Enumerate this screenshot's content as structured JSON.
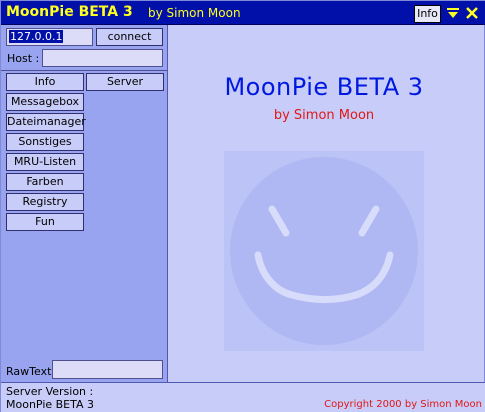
{
  "titlebar": {
    "title": "MoonPie BETA 3",
    "author": "by Simon Moon",
    "info_label": "Info",
    "minimize_glyph": "⯆",
    "close_glyph": "✕"
  },
  "connection": {
    "ip_value": "127.0.0.1",
    "connect_label": "connect",
    "host_label": "Host :",
    "host_value": ""
  },
  "tabs": [
    {
      "label": "Info",
      "active": true
    },
    {
      "label": "Server",
      "active": false
    }
  ],
  "menu": [
    {
      "label": "Messagebox"
    },
    {
      "label": "Dateimanager"
    },
    {
      "label": "Sonstiges"
    },
    {
      "label": "MRU-Listen"
    },
    {
      "label": "Farben"
    },
    {
      "label": "Registry"
    },
    {
      "label": "Fun"
    }
  ],
  "rawtext": {
    "label": "RawText:",
    "value": ""
  },
  "main": {
    "title": "MoonPie BETA 3",
    "subtitle": "by Simon Moon",
    "logo_icon": "smiley-face-icon"
  },
  "status": {
    "server_version_label": "Server Version :",
    "server_version_value": "MoonPie BETA 3",
    "copyright": "Copyright 2000 by Simon Moon"
  },
  "colors": {
    "titlebar_bg": "#0010a8",
    "title_text": "#ffff20",
    "panel_bg": "#98a4f0",
    "main_bg": "#c8ccf8",
    "heading_blue": "#0018e0",
    "accent_red": "#e01818"
  }
}
